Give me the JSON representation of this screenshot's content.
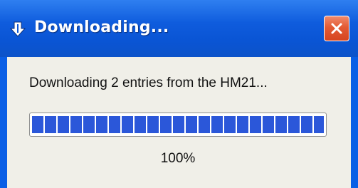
{
  "window": {
    "title": "Downloading...",
    "title_icon": "download-arrow-icon",
    "close_icon": "close-icon"
  },
  "dialog": {
    "message": "Downloading 2 entries from the HM21...",
    "progress_fraction": 1.0,
    "progress_label": "100%"
  },
  "colors": {
    "titlebar": "#0a55d5",
    "close_button": "#e35a33",
    "progress_block": "#2b57d9",
    "client_background": "#f0efe8"
  }
}
